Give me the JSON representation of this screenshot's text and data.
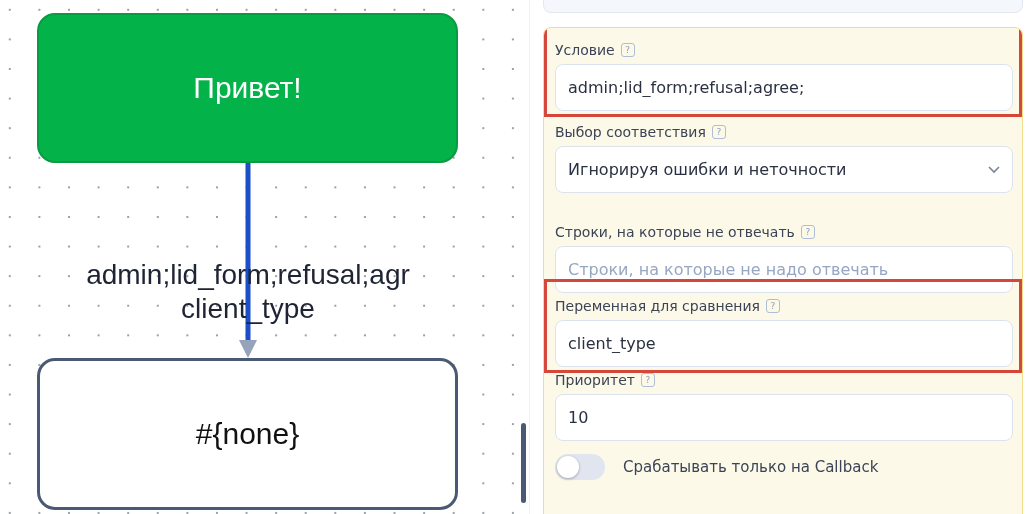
{
  "canvas": {
    "nodes": [
      {
        "kind": "start",
        "text": "Привет!"
      },
      {
        "kind": "plain",
        "text": "#{none}"
      }
    ],
    "edge": {
      "labels": [
        "admin;lid_form;refusal;agr",
        "client_type"
      ]
    }
  },
  "panel": {
    "fields": [
      {
        "kind": "input",
        "label": "Условие",
        "help": "?",
        "value": "admin;lid_form;refusal;agree;",
        "highlighted": true
      },
      {
        "kind": "select",
        "label": "Выбор соответствия",
        "help": "?",
        "value": "Игнорируя ошибки и неточности",
        "highlighted": false
      },
      {
        "kind": "input",
        "label": "Строки, на которые не отвечать",
        "help": "?",
        "placeholder": "Строки, на которые не надо отвечать",
        "highlighted": false
      },
      {
        "kind": "input",
        "label": "Переменная для сравнения",
        "help": "?",
        "value": "client_type",
        "highlighted": true
      },
      {
        "kind": "input",
        "label": "Приоритет",
        "help": "?",
        "value": "10",
        "highlighted": false
      },
      {
        "kind": "toggle",
        "label": "Срабатывать только на Callback",
        "on": false,
        "highlighted": false
      }
    ]
  }
}
